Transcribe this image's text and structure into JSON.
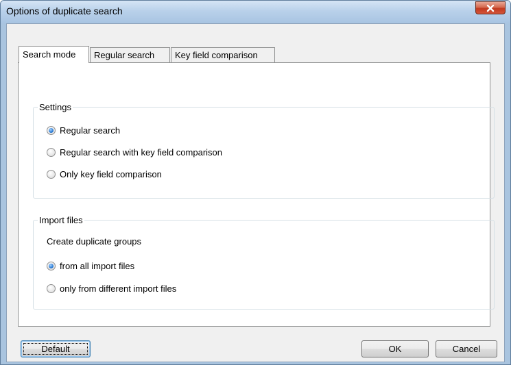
{
  "window": {
    "title": "Options of duplicate search",
    "close_icon": "close-icon"
  },
  "tabs": [
    {
      "label": "Search mode",
      "active": true
    },
    {
      "label": "Regular search",
      "active": false
    },
    {
      "label": "Key field comparison",
      "active": false
    }
  ],
  "settings": {
    "title": "Settings",
    "options": [
      {
        "label": "Regular search",
        "checked": true
      },
      {
        "label": "Regular search with key field comparison",
        "checked": false
      },
      {
        "label": "Only key field comparison",
        "checked": false
      }
    ]
  },
  "import_files": {
    "title": "Import files",
    "subtitle": "Create duplicate groups",
    "options": [
      {
        "label": "from all import files",
        "checked": true
      },
      {
        "label": "only from different import files",
        "checked": false
      }
    ]
  },
  "buttons": {
    "default_label": "Default",
    "ok_label": "OK",
    "cancel_label": "Cancel"
  }
}
